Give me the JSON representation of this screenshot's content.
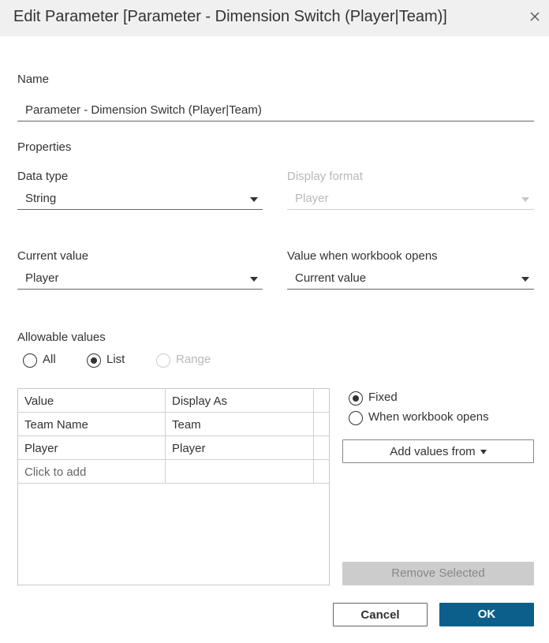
{
  "dialog": {
    "title": "Edit Parameter [Parameter - Dimension Switch (Player|Team)]",
    "close_icon": "close-icon"
  },
  "name": {
    "label": "Name",
    "value": "Parameter - Dimension Switch (Player|Team)"
  },
  "properties": {
    "heading": "Properties",
    "data_type": {
      "label": "Data type",
      "value": "String"
    },
    "display_format": {
      "label": "Display format",
      "value": "Player"
    },
    "current_value": {
      "label": "Current value",
      "value": "Player"
    },
    "value_when_opens": {
      "label": "Value when workbook opens",
      "value": "Current value"
    }
  },
  "allowable": {
    "heading": "Allowable values",
    "options": [
      {
        "label": "All",
        "checked": false,
        "disabled": false
      },
      {
        "label": "List",
        "checked": true,
        "disabled": false
      },
      {
        "label": "Range",
        "checked": false,
        "disabled": true
      }
    ]
  },
  "list_table": {
    "headers": [
      "Value",
      "Display As"
    ],
    "rows": [
      [
        "Team Name",
        "Team"
      ],
      [
        "Player",
        "Player"
      ]
    ],
    "add_placeholder": "Click to add"
  },
  "list_source": {
    "options": [
      {
        "label": "Fixed",
        "checked": true
      },
      {
        "label": "When workbook opens",
        "checked": false
      }
    ],
    "add_values_label": "Add values from",
    "remove_label": "Remove Selected"
  },
  "footer": {
    "cancel_label": "Cancel",
    "ok_label": "OK"
  },
  "colors": {
    "primary_button": "#0b5f8a",
    "titlebar_bg": "#f0f0f0"
  }
}
